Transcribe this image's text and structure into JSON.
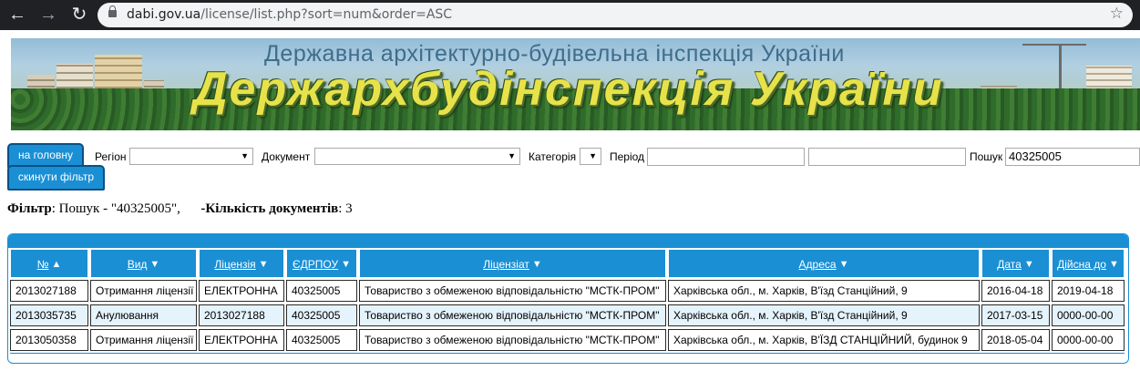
{
  "browser": {
    "url_host": "dabi.gov.ua",
    "url_path": "/license/list.php?sort=num&order=ASC",
    "icons": [
      "back-arrow-icon",
      "forward-arrow-icon",
      "reload-icon",
      "lock-icon",
      "star-icon"
    ]
  },
  "banner": {
    "subtitle": "Державна архітектурно-будівельна інспекція України",
    "title": "Держархбудінспекція України"
  },
  "filters": {
    "home_button": "на головну",
    "reset_button": "скинути фільтр",
    "region_label": "Регіон",
    "region_value": "",
    "document_label": "Документ",
    "document_value": "",
    "category_label": "Категорія",
    "category_value": "",
    "period_label": "Період",
    "period_from": "",
    "period_to": "",
    "search_label": "Пошук",
    "search_value": "40325005"
  },
  "filter_summary": {
    "filter_label": "Фільтр",
    "filter_text": ": Пошук - \"40325005\",",
    "count_label": "-Кількість документів",
    "count_value": ": 3"
  },
  "table": {
    "columns": [
      "№",
      "Вид",
      "Ліцензія",
      "ЄДРПОУ",
      "Ліцензіат",
      "Адреса",
      "Дата",
      "Дійсна до"
    ],
    "sort_arrows": [
      "▲",
      "▼",
      "▼",
      "▼",
      "▼",
      "▼",
      "▼",
      "▼"
    ],
    "rows": [
      [
        "2013027188",
        "Отримання ліцензії",
        "ЕЛЕКТРОННА",
        "40325005",
        "Товариство з обмеженою відповідальністю \"МСТК-ПРОМ\"",
        "Харківська обл., м. Харків,  В'їзд Станційний, 9",
        "2016-04-18",
        "2019-04-18"
      ],
      [
        "2013035735",
        "Анулювання",
        "2013027188",
        "40325005",
        "Товариство з обмеженою відповідальністю \"МСТК-ПРОМ\"",
        "Харківська обл., м. Харків,  В'їзд Станційний, 9",
        "2017-03-15",
        "0000-00-00"
      ],
      [
        "2013050358",
        "Отримання ліцензії",
        "ЕЛЕКТРОННА",
        "40325005",
        "Товариство з обмеженою відповідальністю \"МСТК-ПРОМ\"",
        "Харківська обл., м. Харків,  В'ЇЗД СТАНЦІЙНИЙ, будинок 9",
        "2018-05-04",
        "0000-00-00"
      ]
    ]
  },
  "colors": {
    "accent": "#1a8fd4",
    "row_alt": "#e4f3fc",
    "chrome": "#202124"
  }
}
